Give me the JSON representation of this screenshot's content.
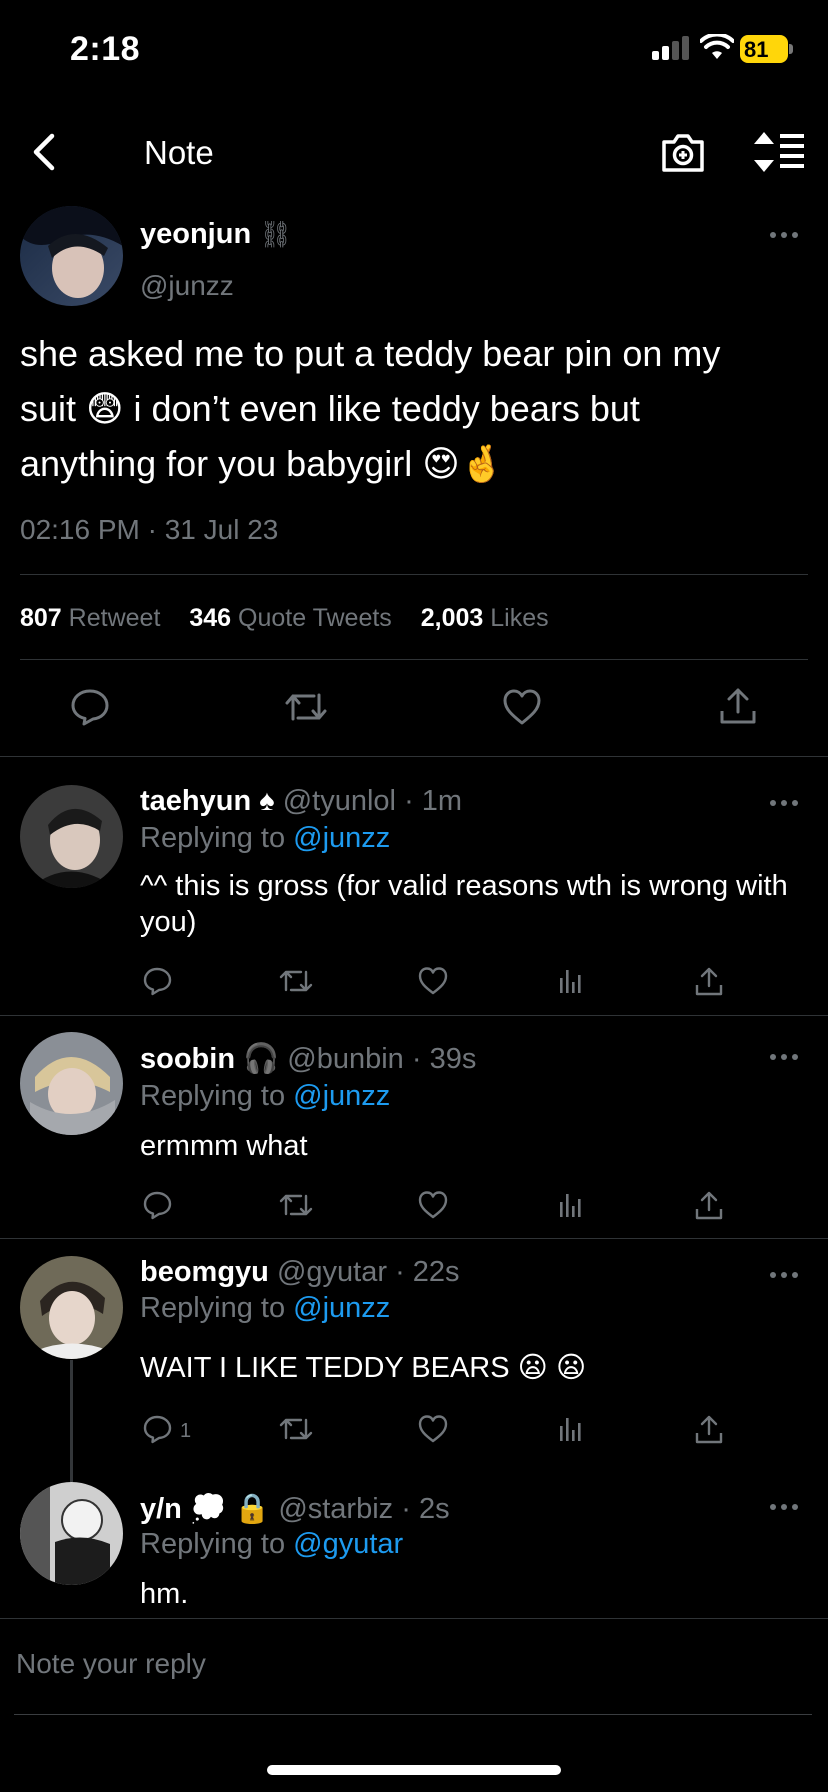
{
  "status_bar": {
    "time": "2:18",
    "battery": "81"
  },
  "header": {
    "title": "Note"
  },
  "tweet": {
    "name": "yeonjun",
    "name_emoji": "⛓",
    "handle": "@junzz",
    "text_line1": "she asked me to put a teddy bear pin on my",
    "text_line2": "suit 😨  i don’t even like teddy bears but",
    "text_line3": "anything for you babygirl 😍🤞",
    "date": "02:16 PM · 31 Jul 23",
    "stats": {
      "retweets": "807",
      "retweets_label": "Retweet",
      "quotes": "346",
      "quotes_label": "Quote Tweets",
      "likes": "2,003",
      "likes_label": "Likes"
    }
  },
  "replies": [
    {
      "name": "taehyun",
      "badge": "♠",
      "handle": "@tyunlol",
      "time": "· 1m",
      "replying_prefix": "Replying to",
      "replying_to": "@junzz",
      "text": "^^ this is gross (for valid reasons wth is wrong with you)",
      "reply_count": ""
    },
    {
      "name": "soobin",
      "badge": "🎧",
      "handle": "@bunbin",
      "time": "· 39s",
      "replying_prefix": "Replying to",
      "replying_to": "@junzz",
      "text": "ermmm what",
      "reply_count": ""
    },
    {
      "name": "beomgyu",
      "badge": "",
      "handle": "@gyutar",
      "time": "· 22s",
      "replying_prefix": "Replying to",
      "replying_to": "@junzz",
      "text": "WAIT I LIKE TEDDY BEARS 😦 😦",
      "reply_count": "1"
    },
    {
      "name": "y/n",
      "badge": "💭 🔒",
      "handle": "@starbiz",
      "time": "· 2s",
      "replying_prefix": "Replying to",
      "replying_to": "@gyutar",
      "text": "hm.",
      "reply_count": ""
    }
  ],
  "compose": {
    "placeholder": "Note your reply"
  },
  "colors": {
    "background": "#000000",
    "text": "#e7e9ea",
    "secondary": "#71767b",
    "accent": "#1d9bf0",
    "battery": "#ffd60a"
  },
  "icons": [
    "signal-icon",
    "wifi-icon",
    "battery-icon",
    "back-arrow-icon",
    "camera-icon",
    "sort-icon",
    "more-icon",
    "reply-icon",
    "retweet-icon",
    "like-icon",
    "views-icon",
    "share-icon"
  ]
}
